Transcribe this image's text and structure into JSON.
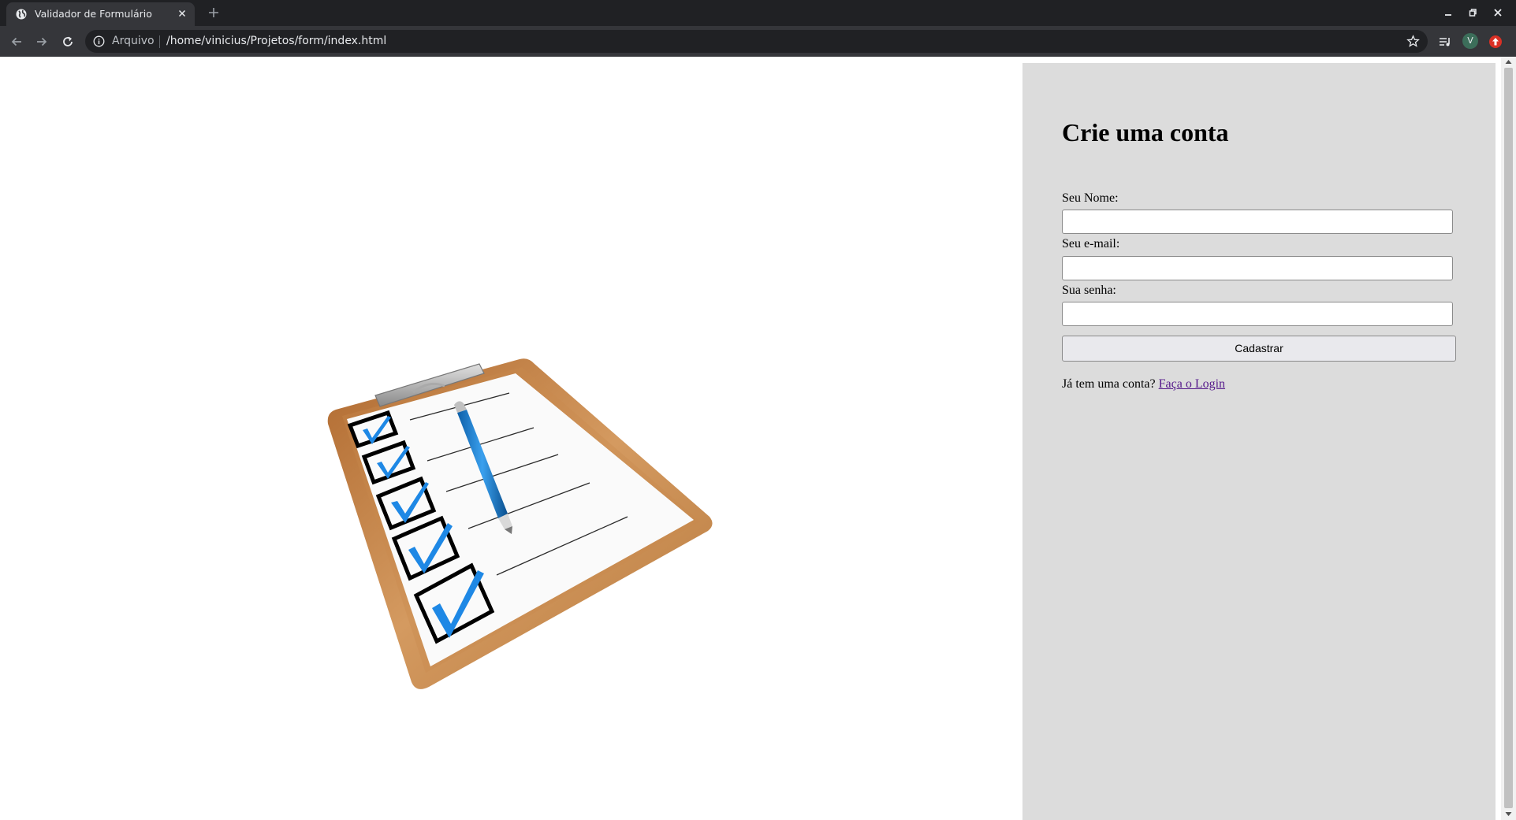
{
  "browser": {
    "tab": {
      "title": "Validador de Formulário",
      "favicon": "globe-icon"
    },
    "address_bar": {
      "scheme_label": "Arquivo",
      "url": "/home/vinicius/Projetos/form/index.html"
    },
    "profile_initial": "V",
    "icons": [
      "back-arrow-icon",
      "forward-arrow-icon",
      "reload-icon",
      "info-icon",
      "star-icon",
      "media-queue-icon",
      "extension-icon",
      "close-icon",
      "new-tab-plus-icon",
      "minimize-icon",
      "restore-icon"
    ]
  },
  "page": {
    "illustration": "clipboard-checklist-with-pen",
    "form": {
      "title": "Crie uma conta",
      "name_label": "Seu Nome:",
      "email_label": "Seu e-mail:",
      "password_label": "Sua senha:",
      "name_value": "",
      "email_value": "",
      "password_value": "",
      "submit_label": "Cadastrar",
      "login_prompt": "Já tem uma conta?",
      "login_link": "Faça o Login"
    }
  },
  "colors": {
    "chrome_dark": "#202124",
    "toolbar": "#35363a",
    "panel_bg": "#dcdcdc",
    "link_visited": "#551a8b",
    "checkmark_blue": "#1e88e5"
  }
}
